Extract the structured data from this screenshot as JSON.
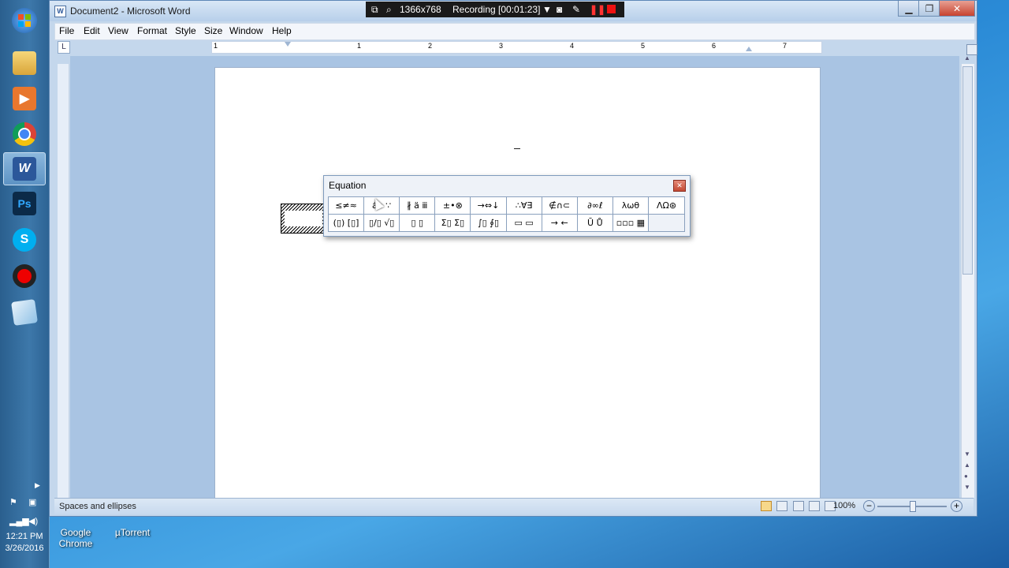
{
  "window": {
    "title": "Document2 - Microsoft Word"
  },
  "recording_bar": {
    "resolution": "1366x768",
    "status": "Recording [00:01:23]"
  },
  "menu": [
    "File",
    "Edit",
    "View",
    "Format",
    "Style",
    "Size",
    "Window",
    "Help"
  ],
  "ruler_numbers": [
    "1",
    "1",
    "2",
    "3",
    "4",
    "5",
    "6",
    "7"
  ],
  "equation_toolbar": {
    "title": "Equation",
    "row1": [
      "≤≠≈",
      "ȧb ∵",
      "∦ ä ⅲ",
      "±•⊗",
      "→⇔↓",
      "∴∀∃",
      "∉∩⊂",
      "∂∞ℓ",
      "λωθ",
      "ΛΩ⊛"
    ],
    "row2": [
      "(▯) [▯]",
      "▯/▯ √▯",
      "▯ ▯",
      "Σ▯ Σ▯",
      "∫▯ ∮▯",
      "▭ ▭",
      "→ ←",
      "Ū Ů",
      "▫▫▫ ▦",
      ""
    ]
  },
  "status": {
    "text": "Spaces and ellipses",
    "zoom": "100%"
  },
  "desktop_icons": [
    {
      "label": "Google Chrome"
    },
    {
      "label": "µTorrent"
    }
  ],
  "clock": {
    "time": "12:21 PM",
    "date": "3/26/2016"
  },
  "taskbar_icons": [
    "start-orb",
    "file-explorer",
    "media-player",
    "chrome",
    "word",
    "photoshop",
    "skype",
    "recorder",
    "notes"
  ]
}
